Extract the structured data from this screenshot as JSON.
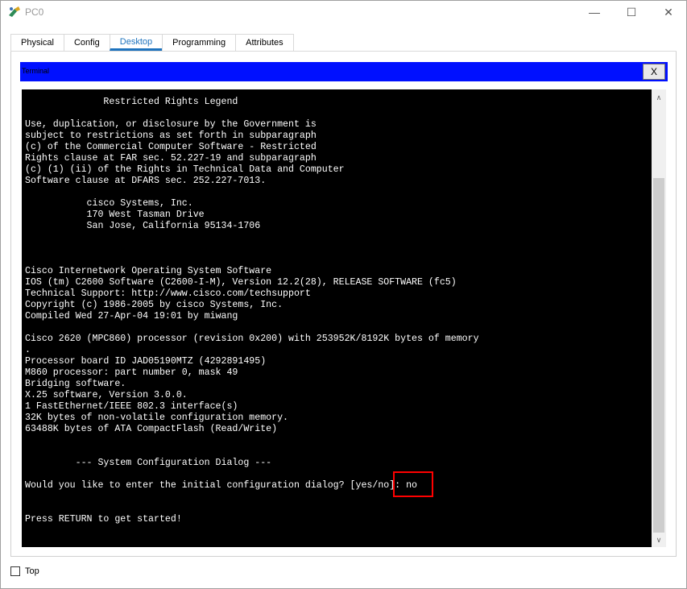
{
  "window": {
    "title": "PC0",
    "minimize": "—",
    "maximize": "☐",
    "close": "✕"
  },
  "tabs": [
    "Physical",
    "Config",
    "Desktop",
    "Programming",
    "Attributes"
  ],
  "active_tab": "Desktop",
  "terminal": {
    "title": "Terminal",
    "close_label": "X",
    "content": "              Restricted Rights Legend\n\nUse, duplication, or disclosure by the Government is\nsubject to restrictions as set forth in subparagraph\n(c) of the Commercial Computer Software - Restricted\nRights clause at FAR sec. 52.227-19 and subparagraph\n(c) (1) (ii) of the Rights in Technical Data and Computer\nSoftware clause at DFARS sec. 252.227-7013.\n\n           cisco Systems, Inc.\n           170 West Tasman Drive\n           San Jose, California 95134-1706\n\n\n\nCisco Internetwork Operating System Software\nIOS (tm) C2600 Software (C2600-I-M), Version 12.2(28), RELEASE SOFTWARE (fc5)\nTechnical Support: http://www.cisco.com/techsupport\nCopyright (c) 1986-2005 by cisco Systems, Inc.\nCompiled Wed 27-Apr-04 19:01 by miwang\n\nCisco 2620 (MPC860) processor (revision 0x200) with 253952K/8192K bytes of memory\n.\nProcessor board ID JAD05190MTZ (4292891495)\nM860 processor: part number 0, mask 49\nBridging software.\nX.25 software, Version 3.0.0.\n1 FastEthernet/IEEE 802.3 interface(s)\n32K bytes of non-volatile configuration memory.\n63488K bytes of ATA CompactFlash (Read/Write)\n\n\n         --- System Configuration Dialog ---\n\nWould you like to enter the initial configuration dialog? [yes/no]: no\n\n\nPress RETURN to get started!"
  },
  "scroll": {
    "up": "∧",
    "down": "∨"
  },
  "top_checkbox": {
    "label": "Top",
    "checked": false
  },
  "colors": {
    "accent": "#1e73be",
    "terminal_titlebar": "#0010ff",
    "highlight": "#ff0000"
  }
}
